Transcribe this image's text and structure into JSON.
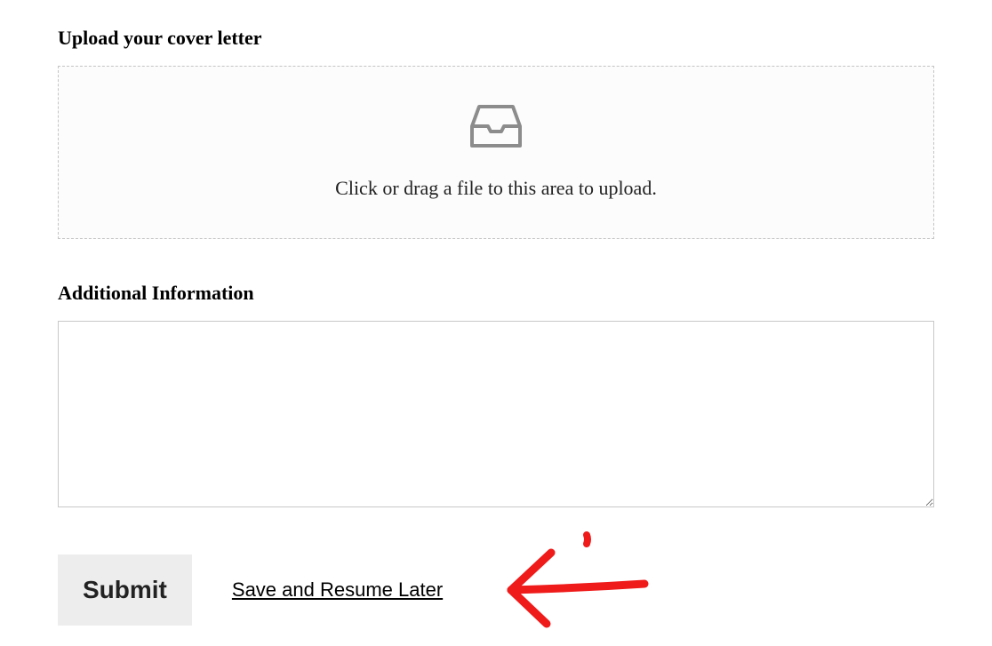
{
  "upload": {
    "label": "Upload your cover letter",
    "instruction": "Click or drag a file to this area to upload."
  },
  "additional": {
    "label": "Additional Information",
    "value": ""
  },
  "actions": {
    "submit": "Submit",
    "save_resume": "Save and Resume Later"
  }
}
